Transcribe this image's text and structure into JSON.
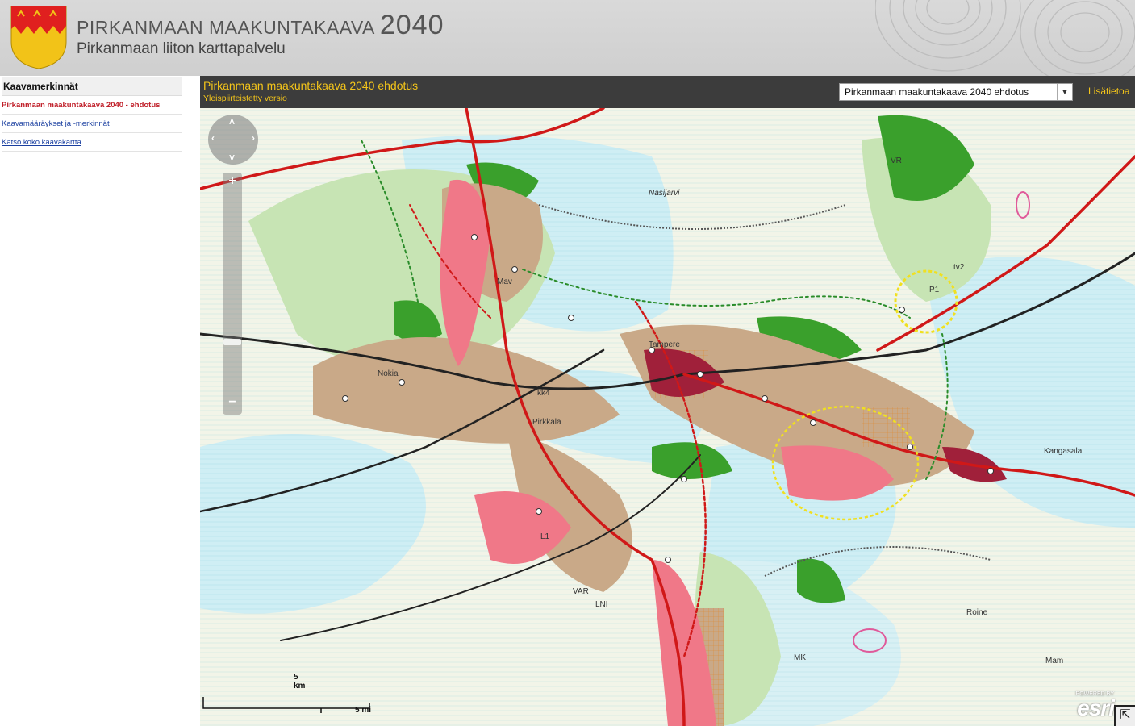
{
  "header": {
    "title": "PIRKANMAAN MAAKUNTAKAAVA",
    "year": "2040",
    "subtitle": "Pirkanmaan liiton karttapalvelu"
  },
  "sidebar": {
    "heading": "Kaavamerkinnät",
    "items": [
      {
        "label": "Pirkanmaan maakuntakaava 2040 - ehdotus",
        "active": true
      },
      {
        "label": "Kaavamääräykset ja -merkinnät",
        "active": false
      },
      {
        "label": "Katso koko kaavakartta",
        "active": false
      }
    ]
  },
  "mapbar": {
    "title": "Pirkanmaan maakuntakaava 2040 ehdotus",
    "subtitle": "Yleispiirteistetty versio",
    "select_value": "Pirkanmaan maakuntakaava 2040 ehdotus",
    "link": "Lisätietoa"
  },
  "map": {
    "labels": [
      "Tampere",
      "Pirkkala",
      "Nokia",
      "Kangasala",
      "Mav",
      "Mam",
      "MK",
      "VR",
      "kk4",
      "tv2",
      "P1",
      "L1",
      "LNI",
      "VAR",
      "Roine",
      "Näsijärvi"
    ],
    "scale_km": "5 km",
    "scale_mi": "5 mi",
    "attribution": "esri",
    "powered_by": "POWERED BY"
  },
  "colors": {
    "accent_yellow": "#f4c51a",
    "bar_dark": "#3c3c3c",
    "active_red": "#c0202a"
  }
}
